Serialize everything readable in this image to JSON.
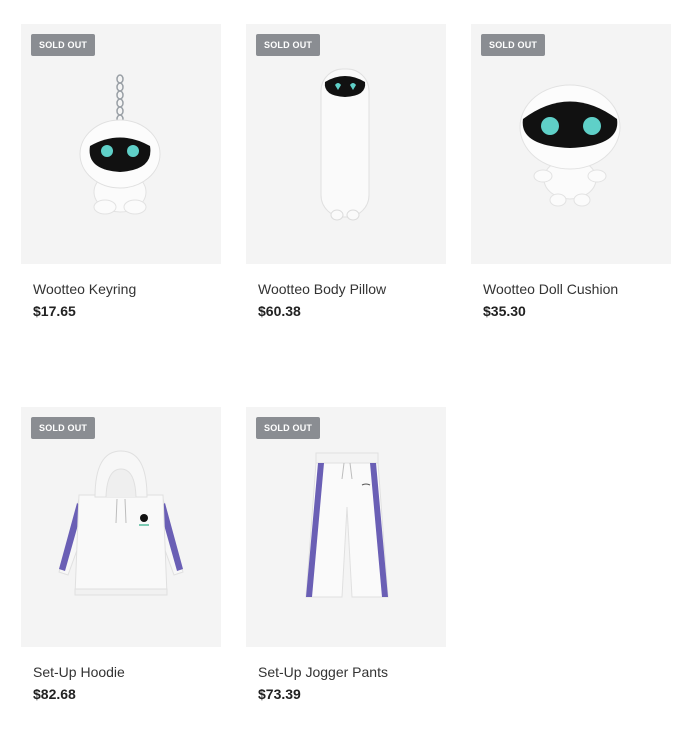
{
  "products": [
    {
      "badge": "SOLD OUT",
      "name": "Wootteo Keyring",
      "price": "$17.65",
      "image": "keyring-plush"
    },
    {
      "badge": "SOLD OUT",
      "name": "Wootteo Body Pillow",
      "price": "$60.38",
      "image": "body-pillow"
    },
    {
      "badge": "SOLD OUT",
      "name": "Wootteo Doll Cushion",
      "price": "$35.30",
      "image": "doll-cushion"
    },
    {
      "badge": "SOLD OUT",
      "name": "Set-Up Hoodie",
      "price": "$82.68",
      "image": "hoodie"
    },
    {
      "badge": "SOLD OUT",
      "name": "Set-Up Jogger Pants",
      "price": "$73.39",
      "image": "jogger-pants"
    }
  ],
  "colors": {
    "thumb_bg": "#f4f4f4",
    "badge_bg": "#8a8d92",
    "accent_purple": "#6a5fb5",
    "eye_cyan": "#5fd0c8"
  }
}
